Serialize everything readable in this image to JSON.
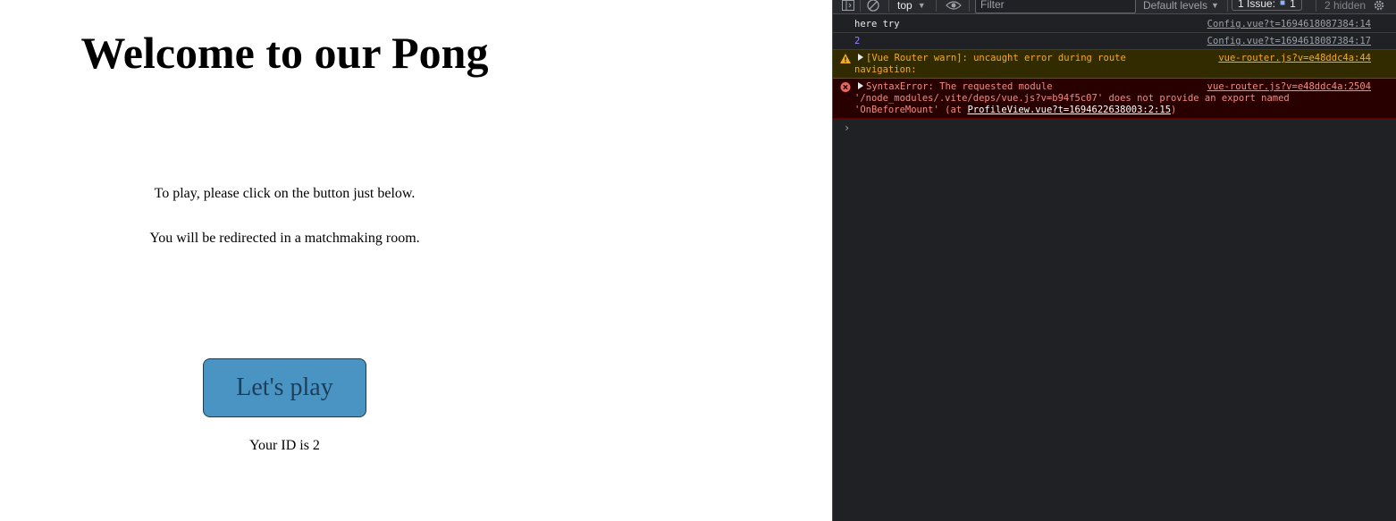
{
  "page": {
    "title": "Welcome to our Pong",
    "instruction_1": "To play, please click on the button just below.",
    "instruction_2": "You will be redirected in a matchmaking room.",
    "play_button_label": "Let's play",
    "user_id_text": "Your ID is 2"
  },
  "devtools": {
    "toolbar": {
      "context": "top",
      "filter_placeholder": "Filter",
      "levels": "Default levels",
      "issues_label": "1 Issue:",
      "issues_count": "1",
      "hidden": "2 hidden"
    },
    "console": {
      "rows": [
        {
          "level": "log",
          "message": "here try",
          "source": "Config.vue?t=1694618087384:14"
        },
        {
          "level": "log",
          "message": "2",
          "source": "Config.vue?t=1694618087384:17"
        },
        {
          "level": "warn",
          "message": "[Vue Router warn]: uncaught error during route",
          "message_2": "navigation:",
          "source": "vue-router.js?v=e48ddc4a:44"
        },
        {
          "level": "error",
          "message": "SyntaxError: The requested module",
          "message_2": "'/node_modules/.vite/deps/vue.js?v=b94f5c07' does not provide an export named",
          "message_3_prefix": "'OnBeforeMount' (at ",
          "message_3_link": "ProfileView.vue?t=1694622638003:2:15",
          "message_3_suffix": ")",
          "source": "vue-router.js?v=e48ddc4a:2504"
        }
      ],
      "prompt": "›"
    },
    "colors": {
      "warn_bg": "#332b00",
      "error_bg": "#290000",
      "button_bg": "#4a94c4"
    }
  }
}
